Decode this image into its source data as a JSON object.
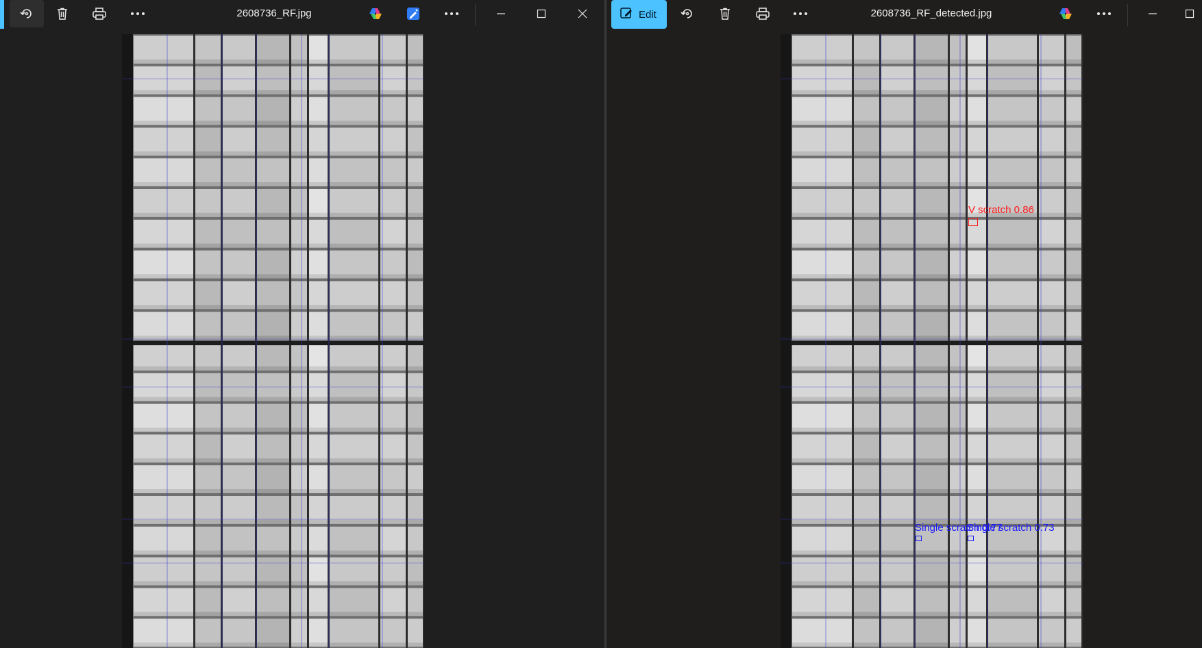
{
  "left_window": {
    "title": "2608736_RF.jpg",
    "toolbar_icons": [
      "rotate-icon",
      "delete-icon",
      "print-icon",
      "more-icon",
      "copilot-icon",
      "designer-icon",
      "more-icon"
    ],
    "window_controls": [
      "minimize-icon",
      "maximize-icon",
      "close-icon"
    ]
  },
  "right_window": {
    "title": "2608736_RF_detected.jpg",
    "edit_label": "Edit",
    "toolbar_icons": [
      "edit-icon",
      "rotate-icon",
      "delete-icon",
      "print-icon",
      "more-icon",
      "copilot-icon",
      "more-icon"
    ],
    "window_controls": [
      "minimize-icon",
      "maximize-icon"
    ],
    "detections": [
      {
        "label": "V scratch 0.86",
        "color": "#ff1a1a"
      },
      {
        "label": "Single scratch 0.77",
        "color": "#1a1aff"
      },
      {
        "label": "Single scratch 0.73",
        "color": "#1a1aff"
      }
    ]
  },
  "colors": {
    "accent": "#4cc2ff",
    "background": "#1f1f1f",
    "detection_red": "#ff1a1a",
    "detection_blue": "#1a1aff"
  }
}
